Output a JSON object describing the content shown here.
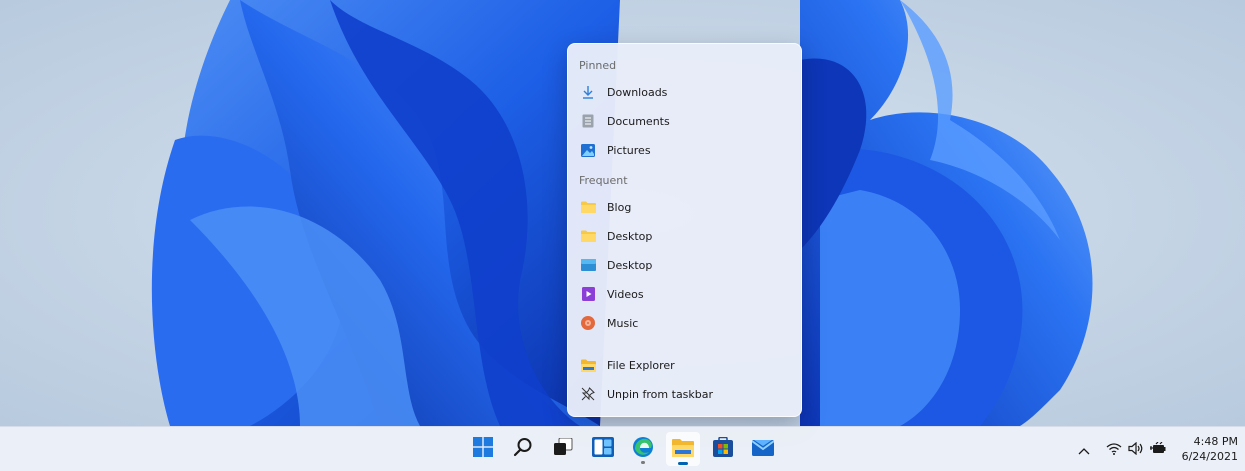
{
  "jumplist": {
    "pinned_header": "Pinned",
    "pinned": [
      {
        "label": "Downloads",
        "icon": "download-icon"
      },
      {
        "label": "Documents",
        "icon": "documents-icon"
      },
      {
        "label": "Pictures",
        "icon": "pictures-icon"
      }
    ],
    "frequent_header": "Frequent",
    "frequent": [
      {
        "label": "Blog",
        "icon": "folder-icon"
      },
      {
        "label": "Desktop",
        "icon": "folder-icon"
      },
      {
        "label": "Desktop",
        "icon": "desktop-icon"
      },
      {
        "label": "Videos",
        "icon": "videos-icon"
      },
      {
        "label": "Music",
        "icon": "music-icon"
      }
    ],
    "tasks": [
      {
        "label": "File Explorer",
        "icon": "file-explorer-icon"
      },
      {
        "label": "Unpin from taskbar",
        "icon": "unpin-icon"
      }
    ]
  },
  "taskbar": {
    "apps": [
      "start-icon",
      "search-icon",
      "task-view-icon",
      "widgets-icon",
      "edge-icon",
      "file-explorer-icon",
      "store-icon",
      "mail-icon"
    ],
    "active_app": "file-explorer-icon"
  },
  "tray": {
    "icons": [
      "chevron-up-icon",
      "wifi-icon",
      "volume-icon",
      "battery-icon"
    ],
    "time": "4:48 PM",
    "date": "6/24/2021"
  },
  "colors": {
    "accent": "#0063b1",
    "wallpaper_blue": "#1a5be8"
  }
}
